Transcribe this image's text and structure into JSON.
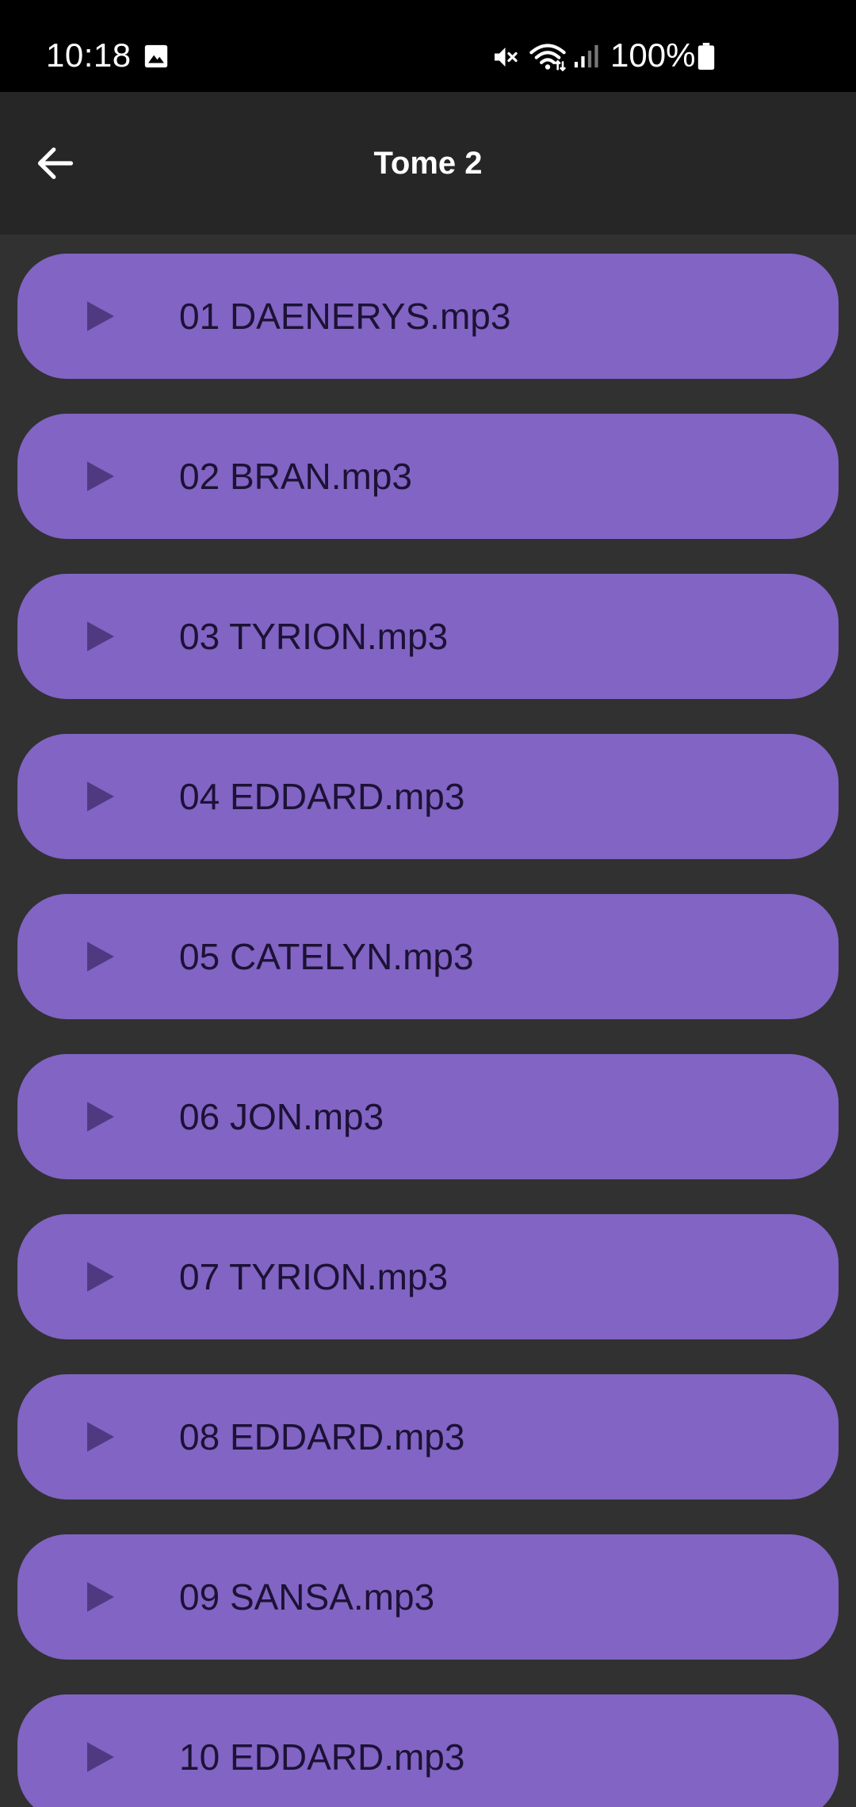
{
  "status_bar": {
    "time": "10:18",
    "battery_text": "100%",
    "icons": [
      "image-icon",
      "mute-icon",
      "wifi-icon",
      "signal-icon",
      "battery-icon"
    ]
  },
  "app_bar": {
    "title": "Tome 2",
    "back_icon": "arrow-left-icon"
  },
  "colors": {
    "status_bar_bg": "#000000",
    "app_bar_bg": "#262626",
    "page_bg": "#313131",
    "track_bg": "#8264c4",
    "track_text": "#1c1235",
    "play_icon": "#4f3a82"
  },
  "tracks": [
    {
      "label": "01 DAENERYS.mp3"
    },
    {
      "label": "02 BRAN.mp3"
    },
    {
      "label": "03 TYRION.mp3"
    },
    {
      "label": "04 EDDARD.mp3"
    },
    {
      "label": "05 CATELYN.mp3"
    },
    {
      "label": "06 JON.mp3"
    },
    {
      "label": "07 TYRION.mp3"
    },
    {
      "label": "08 EDDARD.mp3"
    },
    {
      "label": "09 SANSA.mp3"
    },
    {
      "label": "10 EDDARD.mp3"
    }
  ]
}
